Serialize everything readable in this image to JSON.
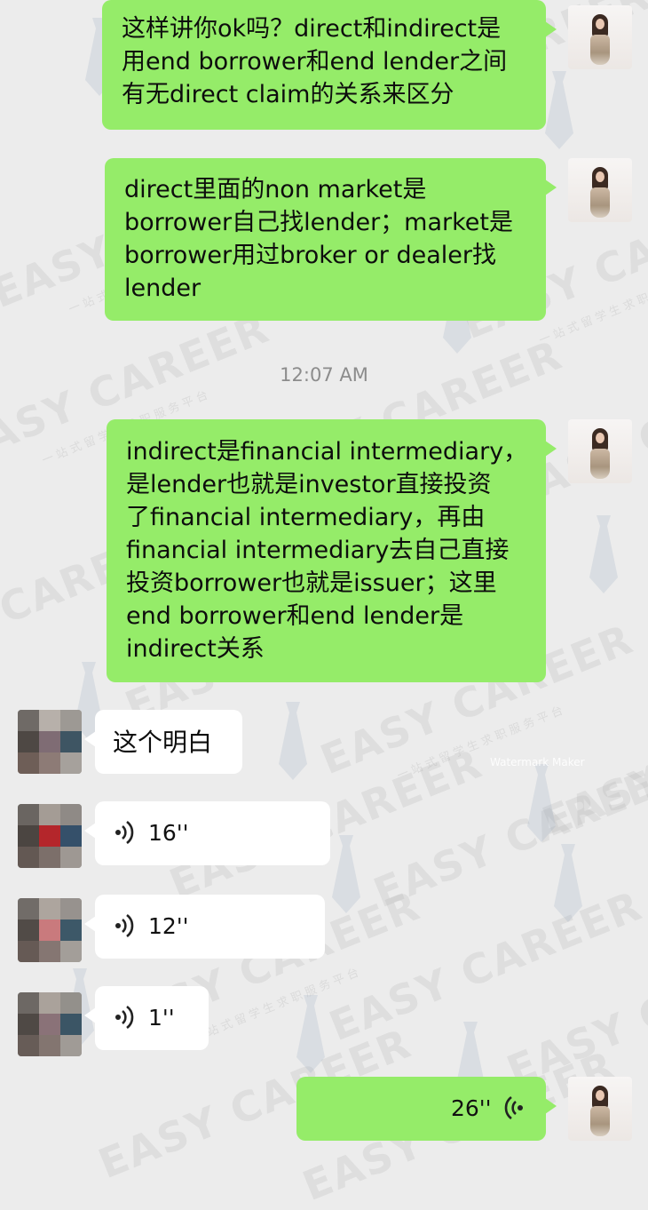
{
  "conversation": {
    "timestamp": "12:07 AM",
    "messages": [
      {
        "side": "self",
        "type": "text",
        "lines": [
          "这样讲你ok吗？direct和indirect是",
          "用end borrower和end lender之间",
          "有无direct claim的关系来区分"
        ]
      },
      {
        "side": "self",
        "type": "text",
        "lines": [
          "direct里面的non market是",
          "borrower自己找lender；market是",
          "borrower用过broker or dealer找",
          "lender"
        ]
      },
      {
        "side": "self",
        "type": "text",
        "lines": [
          "indirect是financial intermediary，",
          "是lender也就是investor直接投资",
          "了financial intermediary，再由",
          "financial intermediary去自己直接",
          "投资borrower也就是issuer；这里",
          "end borrower和end lender是",
          "indirect关系"
        ]
      },
      {
        "side": "other",
        "type": "text",
        "lines": [
          "这个明白"
        ]
      },
      {
        "side": "other",
        "type": "voice",
        "duration": "16''",
        "icon": "voice-wave-icon"
      },
      {
        "side": "other",
        "type": "voice",
        "duration": "12''",
        "icon": "voice-wave-icon"
      },
      {
        "side": "other",
        "type": "voice",
        "duration": "1''",
        "icon": "voice-wave-icon"
      },
      {
        "side": "self",
        "type": "voice",
        "duration": "26''",
        "icon": "voice-wave-icon"
      }
    ]
  },
  "watermark": {
    "brand": "EASY CAREER",
    "tagline": "一站式留学生求职服务平台",
    "maker": "Watermark Maker"
  },
  "colors": {
    "self_bubble": "#95ec69",
    "other_bubble": "#ffffff",
    "background": "#ececec",
    "timestamp": "#8c8c8c"
  }
}
